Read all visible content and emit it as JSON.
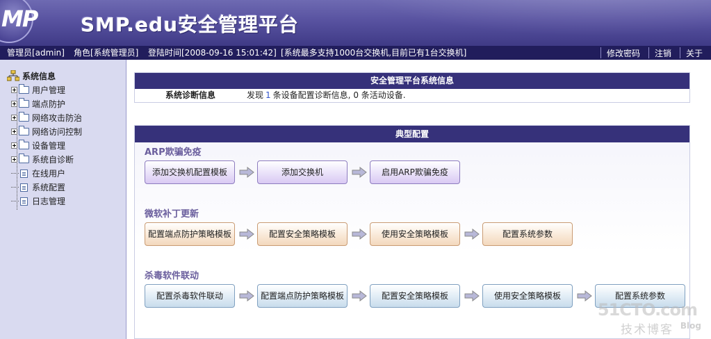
{
  "header": {
    "logo_text": "MP",
    "title": "SMP.edu安全管理平台"
  },
  "statusbar": {
    "admin": "管理员[admin]",
    "role": "角色[系统管理员]",
    "login_time": "登陆时间[2008-09-16 15:01:42]",
    "capacity": "[系统最多支持1000台交换机,目前已有1台交换机]",
    "change_password": "修改密码",
    "logout": "注销",
    "about": "关于"
  },
  "sidebar": {
    "root": "系统信息",
    "items": [
      {
        "label": "用户管理",
        "type": "folder"
      },
      {
        "label": "端点防护",
        "type": "folder"
      },
      {
        "label": "网络攻击防治",
        "type": "folder"
      },
      {
        "label": "网络访问控制",
        "type": "folder"
      },
      {
        "label": "设备管理",
        "type": "folder"
      },
      {
        "label": "系统自诊断",
        "type": "folder"
      },
      {
        "label": "在线用户",
        "type": "doc"
      },
      {
        "label": "系统配置",
        "type": "doc"
      },
      {
        "label": "日志管理",
        "type": "doc"
      }
    ]
  },
  "info_panel": {
    "title": "安全管理平台系统信息",
    "key": "系统诊断信息",
    "text_prefix": "发现",
    "count_config": "1",
    "text_mid": "条设备配置诊断信息,",
    "count_active": "0",
    "text_suffix": "条活动设备."
  },
  "config_panel": {
    "title": "典型配置",
    "sections": [
      {
        "title": "ARP欺骗免疫",
        "color": "purple",
        "steps": [
          "添加交换机配置模板",
          "添加交换机",
          "启用ARP欺骗免疫"
        ]
      },
      {
        "title": "微软补丁更新",
        "color": "orange",
        "steps": [
          "配置端点防护策略模板",
          "配置安全策略模板",
          "使用安全策略模板",
          "配置系统参数"
        ]
      },
      {
        "title": "杀毒软件联动",
        "color": "blue",
        "steps": [
          "配置杀毒软件联动",
          "配置端点防护策略模板",
          "配置安全策略模板",
          "使用安全策略模板",
          "配置系统参数"
        ]
      }
    ]
  },
  "watermark": {
    "site": "51CTO.com",
    "text": "技术博客",
    "blog": "Blog"
  },
  "colors": {
    "header_top": "#6e6ab2",
    "statusbar": "#211d5c",
    "panel_head": "#36317a",
    "sidebar_bg": "#d9daf0",
    "section_title": "#6a5e9d"
  },
  "icons": [
    "org-tree-icon",
    "expand-icon",
    "folder-icon",
    "document-icon",
    "arrow-right-icon"
  ]
}
